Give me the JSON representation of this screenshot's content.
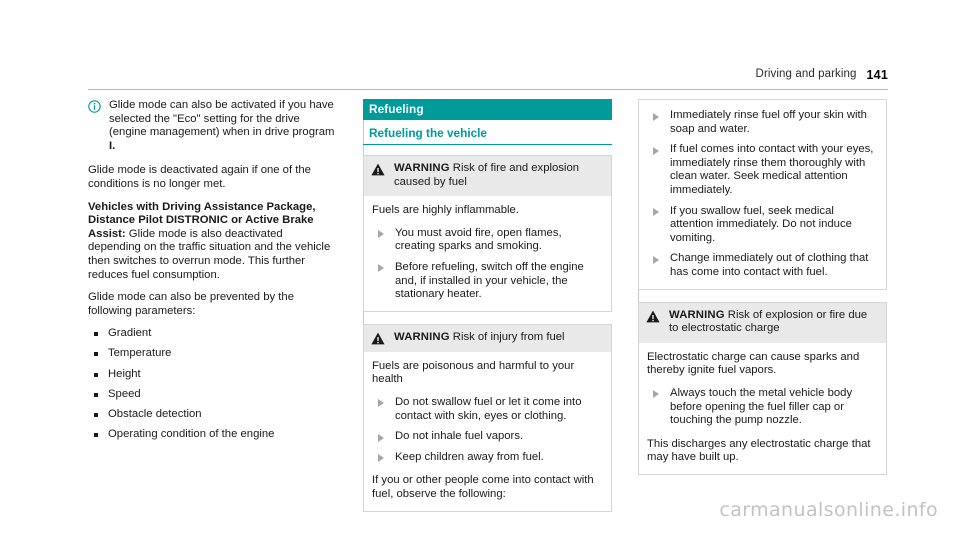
{
  "header": {
    "title": "Driving and parking",
    "page_number": "141",
    "accent_color": "#009a9a"
  },
  "left_column": {
    "note": {
      "icon": "info-circle-icon",
      "text_parts": [
        "Glide mode can also be activated if you have selected the \"Eco\" setting for the drive (engine management) when in drive program ",
        "I."
      ],
      "text": "Glide mode can also be activated if you have selected the \"Eco\" setting for the drive (engine management) when in drive program I."
    },
    "paragraph_1": "Glide mode is deactivated again if one of the conditions is no longer met.",
    "paragraph_2_bold": "Vehicles with Driving Assistance Package, Distance Pilot DISTRONIC or Active Brake Assist:",
    "paragraph_2_rest": " Glide mode is also deactivated depending on the traffic situation and the vehicle then switches to overrun mode. This further reduces fuel consumption.",
    "paragraph_3": "Glide mode can also be prevented by the following parameters:",
    "parameters": [
      "Gradient",
      "Temperature",
      "Height",
      "Speed",
      "Obstacle detection",
      "Operating condition of the engine"
    ]
  },
  "middle_column": {
    "section_title": "Refueling",
    "subsection_title": "Refueling the vehicle",
    "warning_1": {
      "icon": "warning-triangle-icon",
      "label": "WARNING",
      "headline": " Risk of fire and explosion caused by fuel",
      "intro": "Fuels are highly inflammable.",
      "actions": [
        "You must avoid fire, open flames, creating sparks and smoking.",
        "Before refueling, switch off the engine and, if installed in your vehicle, the stationary heater."
      ]
    },
    "warning_2": {
      "icon": "warning-triangle-icon",
      "label": "WARNING",
      "headline": " Risk of injury from fuel",
      "intro": "Fuels are poisonous and harmful to your health",
      "actions": [
        "Do not swallow fuel or let it come into contact with skin, eyes or clothing.",
        "Do not inhale fuel vapors.",
        "Keep children away from fuel."
      ],
      "outro": "If you or other people come into contact with fuel, observe the following:"
    }
  },
  "right_column": {
    "continued_actions": [
      "Immediately rinse fuel off your skin with soap and water.",
      "If fuel comes into contact with your eyes, immediately rinse them thoroughly with clean water. Seek medical attention immediately.",
      "If you swallow fuel, seek medical attention immediately. Do not induce vomiting.",
      "Change immediately out of clothing that has come into contact with fuel."
    ],
    "warning_3": {
      "icon": "warning-triangle-icon",
      "label": "WARNING",
      "headline": " Risk of explosion or fire due to electrostatic charge",
      "intro": "Electrostatic charge can cause sparks and thereby ignite fuel vapors.",
      "actions": [
        "Always touch the metal vehicle body before opening the fuel filler cap or touching the pump nozzle."
      ],
      "outro": "This discharges any electrostatic charge that may have built up."
    }
  },
  "watermark": "carmanualsonline.info"
}
